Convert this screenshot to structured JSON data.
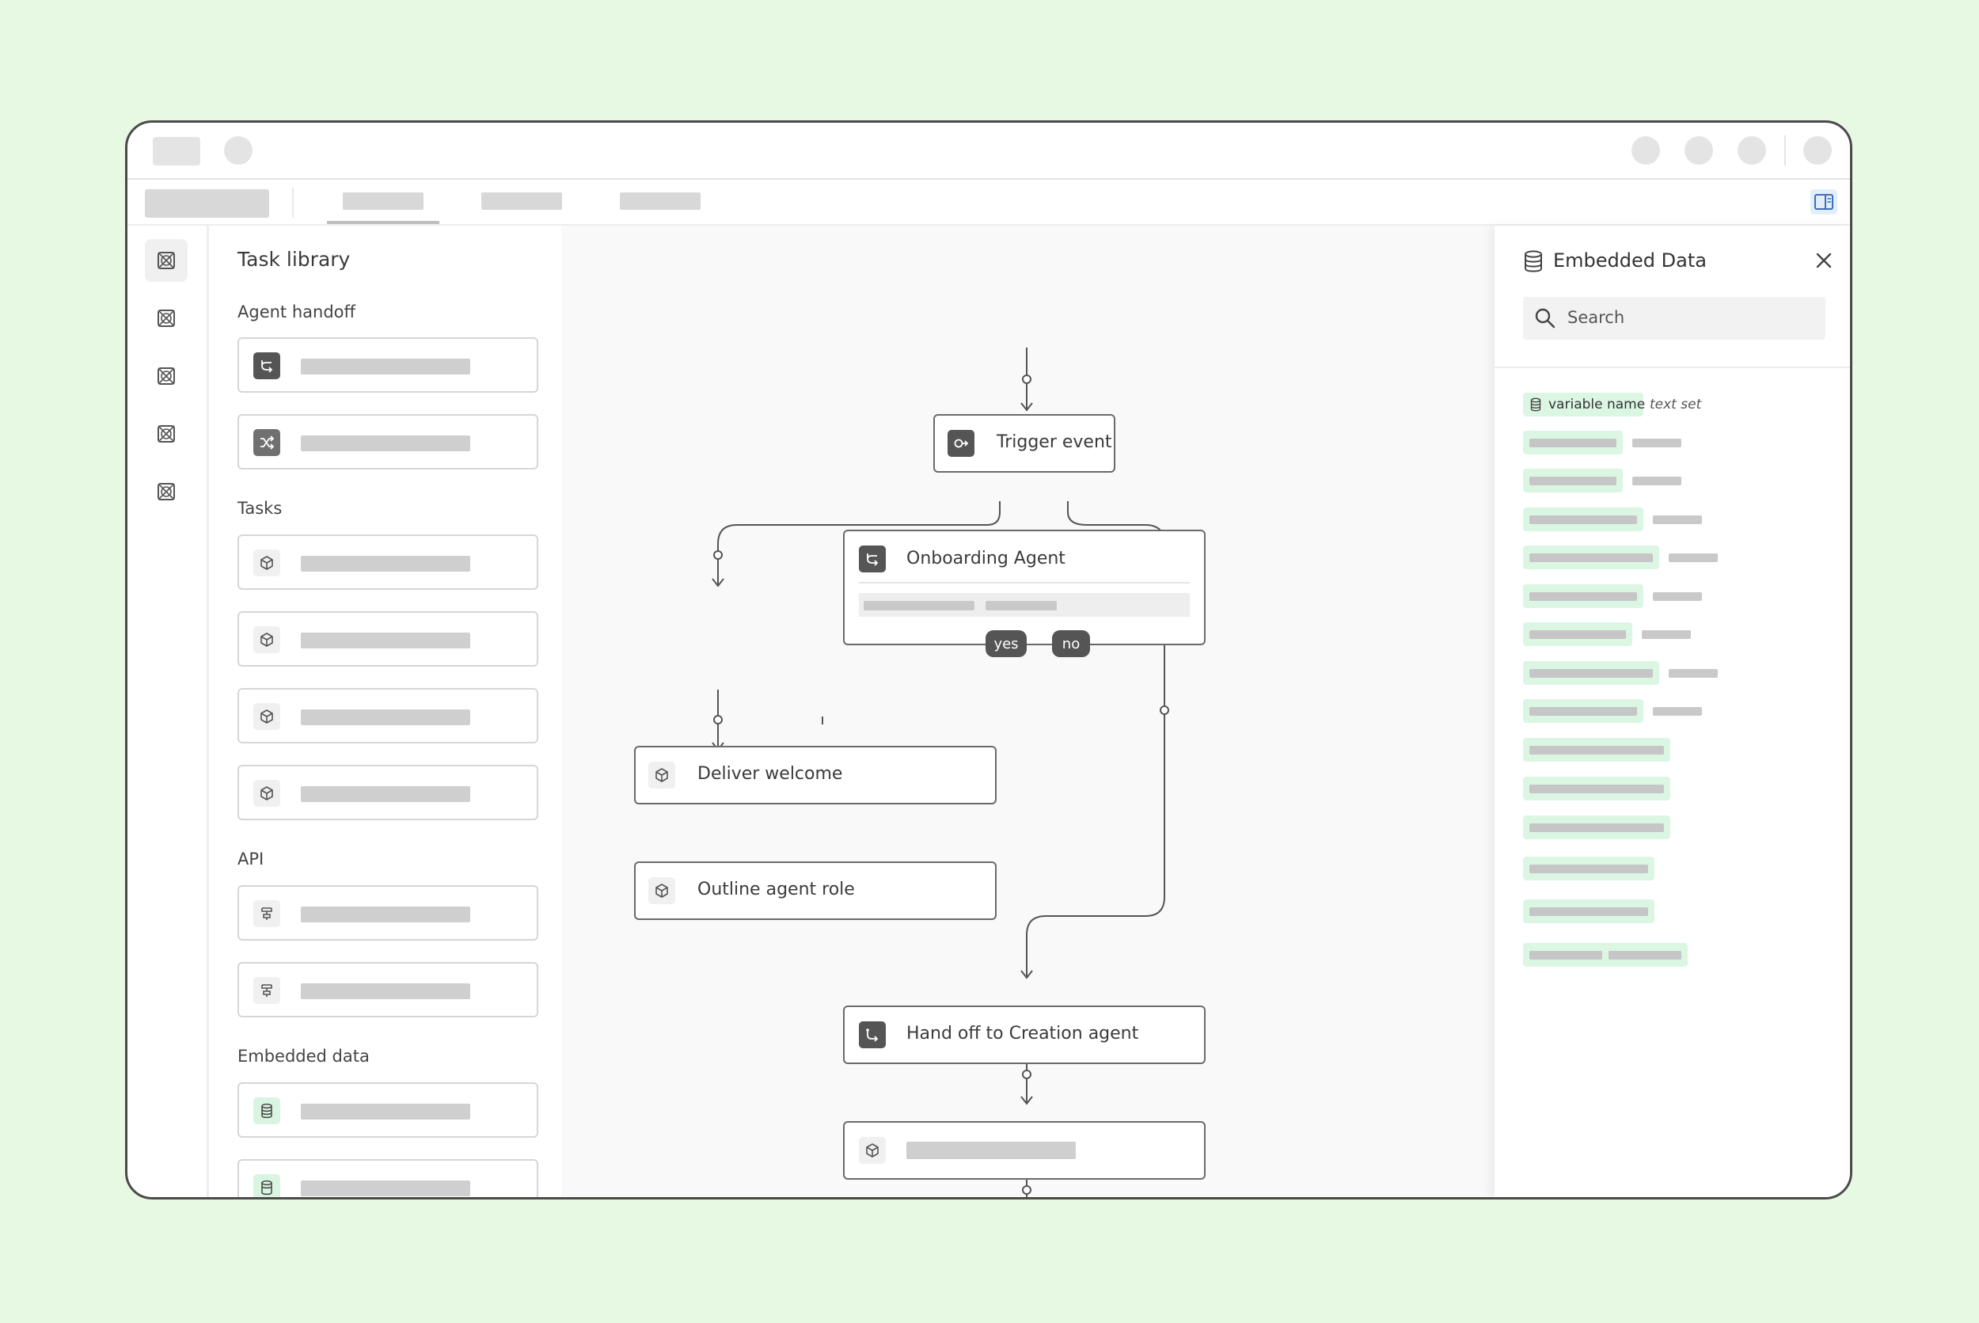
{
  "library": {
    "title": "Task library",
    "sections": {
      "agent_handoff": "Agent handoff",
      "tasks": "Tasks",
      "api": "API",
      "embedded_data": "Embedded data"
    }
  },
  "canvas": {
    "nodes": {
      "trigger": "Trigger event",
      "onboarding": "Onboarding Agent",
      "deliver": "Deliver welcome",
      "outline": "Outline agent role",
      "handoff": "Hand off to Creation agent"
    },
    "branches": {
      "yes": "yes",
      "no": "no"
    }
  },
  "panel": {
    "title": "Embedded Data",
    "search_placeholder": "Search",
    "first_row": {
      "name": "variable name",
      "type": "text set"
    }
  },
  "colors": {
    "background": "#e8f9e3",
    "chip": "#dcf6e4",
    "node_icon": "#555555"
  }
}
